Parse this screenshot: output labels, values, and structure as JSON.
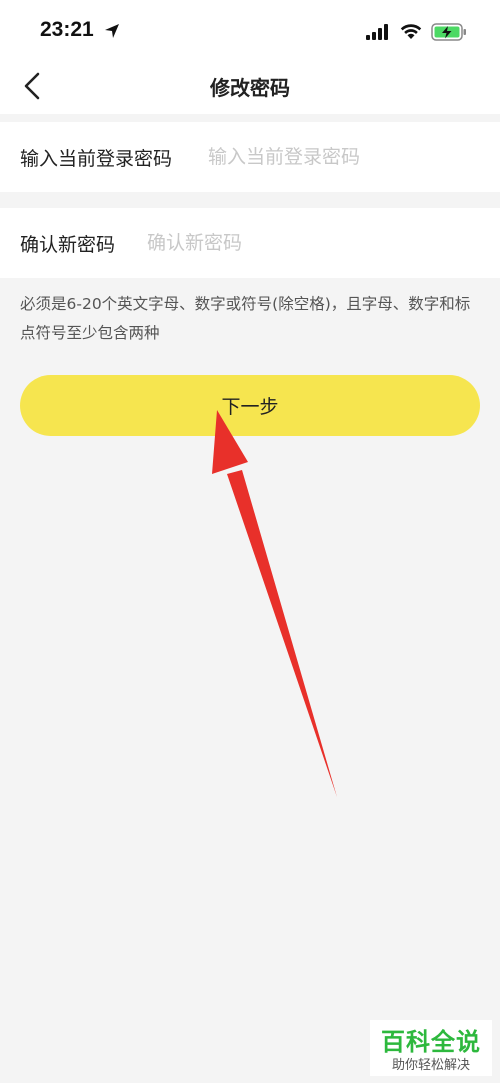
{
  "status_bar": {
    "time": "23:21",
    "icons": [
      "location-arrow-icon",
      "cellular-signal-icon",
      "wifi-icon",
      "battery-charging-icon"
    ]
  },
  "nav": {
    "back_icon": "chevron-left-icon",
    "title": "修改密码"
  },
  "form": {
    "current_password": {
      "label": "输入当前登录密码",
      "placeholder": "输入当前登录密码",
      "value": ""
    },
    "confirm_password": {
      "label": "确认新密码",
      "placeholder": "确认新密码",
      "value": ""
    },
    "hint": "必须是6-20个英文字母、数字或符号(除空格)，且字母、数字和标点符号至少包含两种"
  },
  "next_button": {
    "label": "下一步"
  },
  "watermark": {
    "title": "百科全说",
    "subtitle": "助你轻松解决"
  },
  "colors": {
    "accent_button": "#f6e54f",
    "annotation_arrow": "#e8302a",
    "watermark_green": "#2db83d",
    "battery_green": "#4cd964",
    "page_background": "#f4f4f4"
  }
}
